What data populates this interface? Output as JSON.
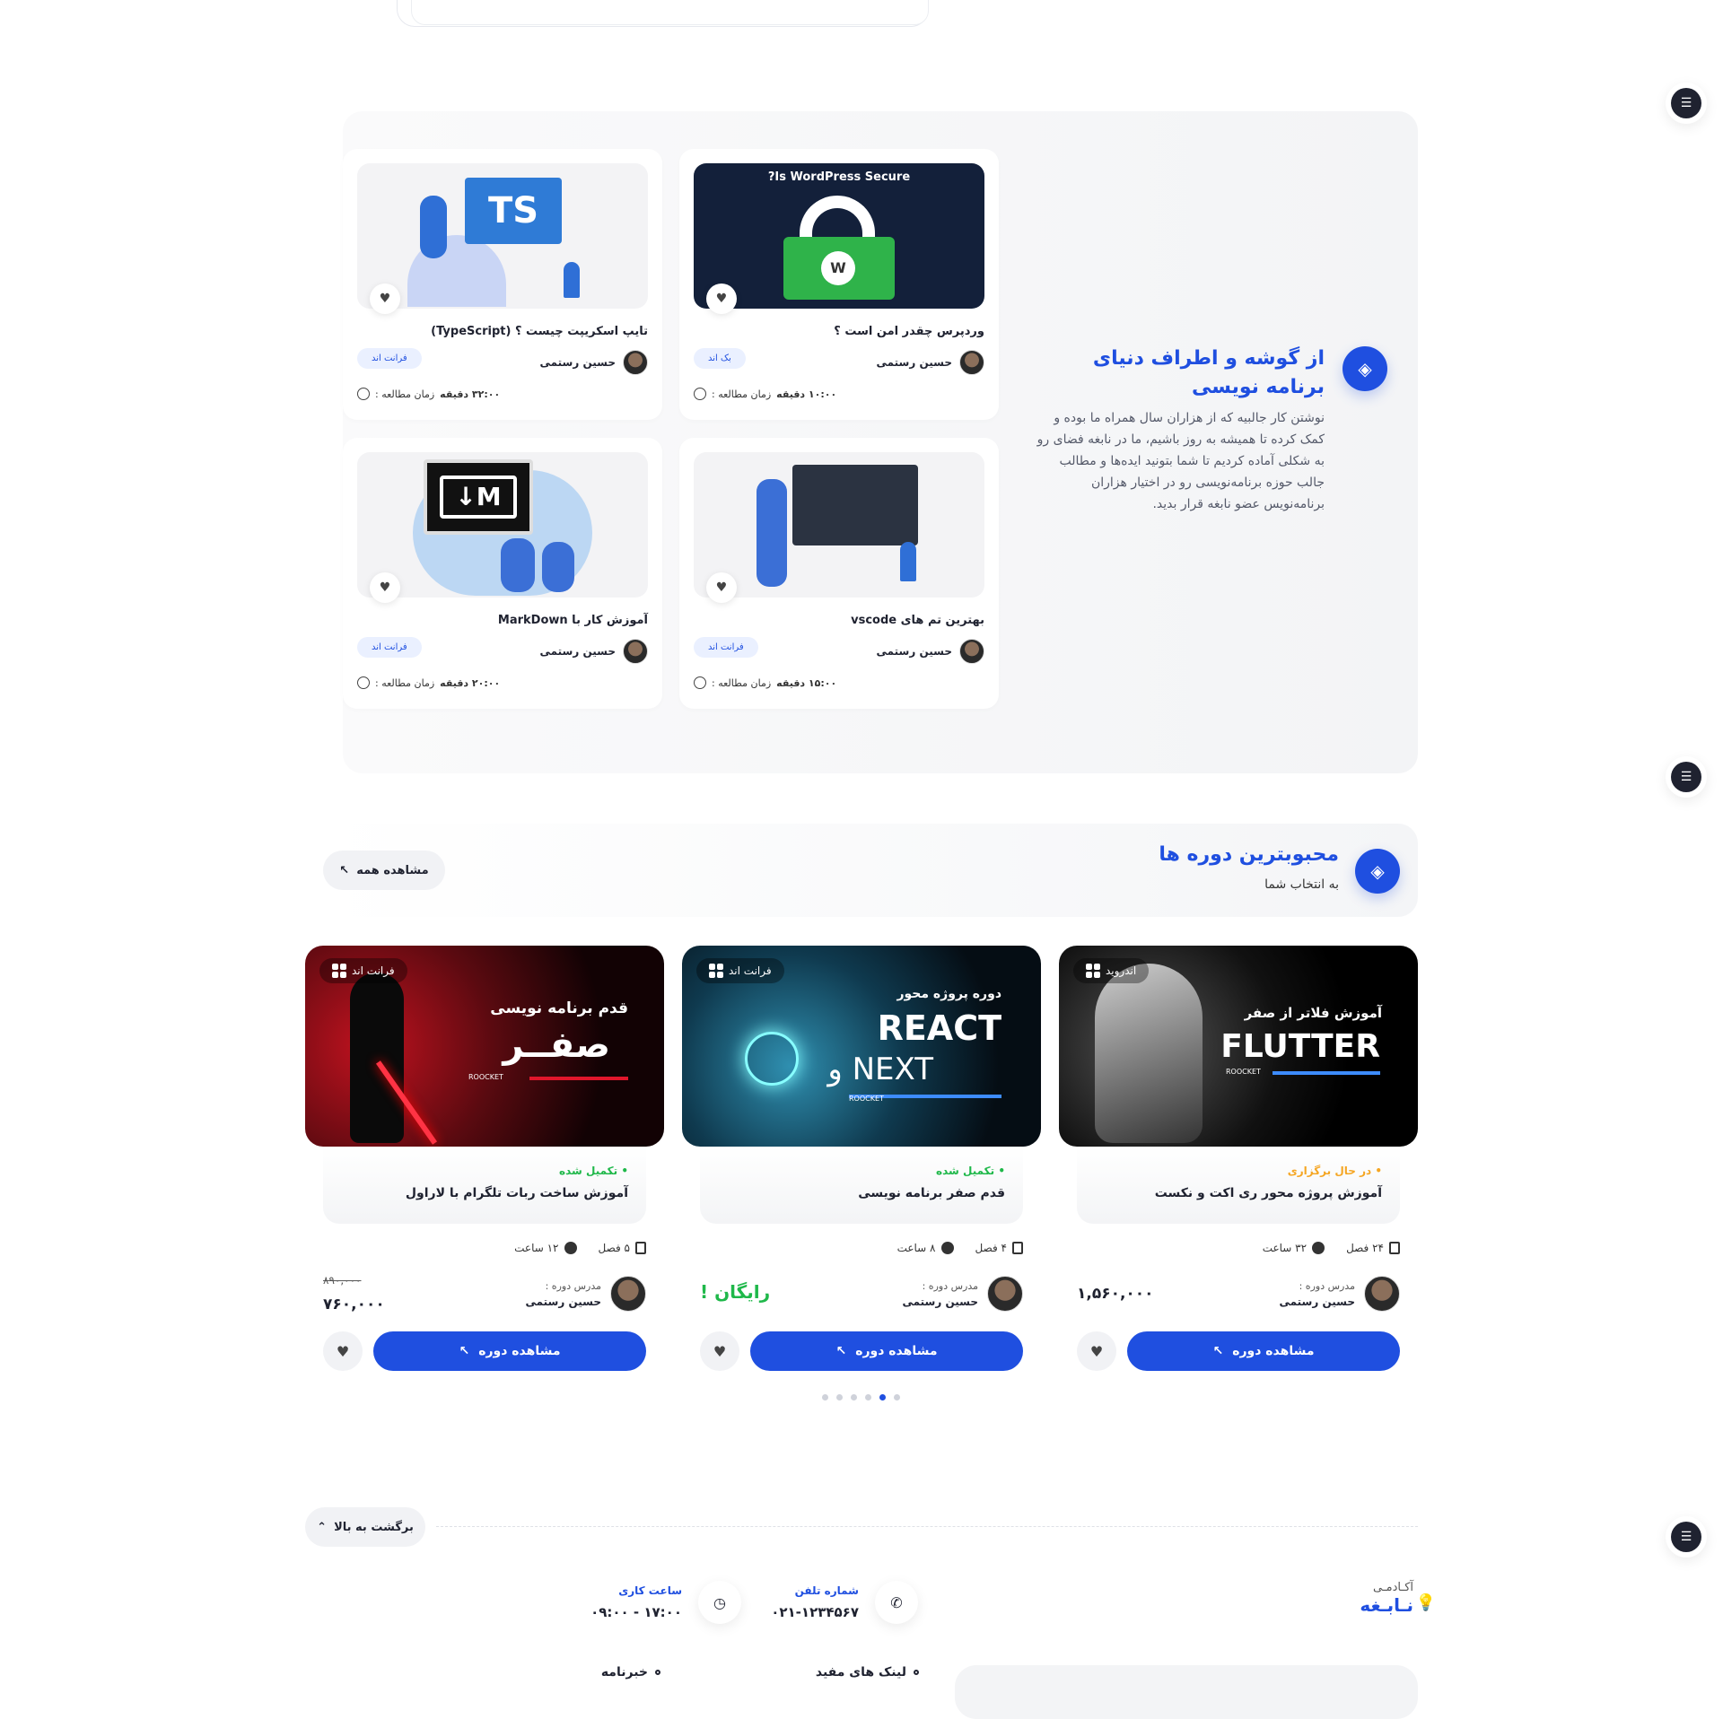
{
  "blog": {
    "title": "از گوشه و اطراف دنیای برنامه نویسی",
    "description": "نوشتن کار جالبیه که از هزاران سال همراه ما بوده و کمک کرده تا همیشه به روز باشیم، ما در نابغه فضای رو به شکلی آماده کردیم تا شما بتونید ایده‌ها و مطالب جالب حوزه برنامه‌نویسی رو در اختیار هزاران برنامه‌نویس عضو نابغه قرار بدید.",
    "read_label": "زمان مطالعه :",
    "posts": [
      {
        "title": "وردپرس چقدر امن است ؟",
        "author": "حسین رستمی",
        "tag": "بک اند",
        "read_time": "۱۰:۰۰ دقیقه",
        "image_text": "Is WordPress Secure?"
      },
      {
        "title": "تایپ اسکریپت چیست ؟ (TypeScript)",
        "author": "حسین رستمی",
        "tag": "فرانت اند",
        "read_time": "۳۲:۰۰ دقیقه",
        "image_text": "TS"
      },
      {
        "title": "بهترین تم های vscode",
        "author": "حسین رستمی",
        "tag": "فرانت اند",
        "read_time": "۱۵:۰۰ دقیقه"
      },
      {
        "title": "آموزش کار با MarkDown",
        "author": "حسین رستمی",
        "tag": "فرانت اند",
        "read_time": "۲۰:۰۰ دقیقه",
        "image_text": "M↓"
      }
    ]
  },
  "popular": {
    "title": "محبوبترین دوره ها",
    "subtitle": "به انتخاب شما",
    "see_all": "مشاهده همه",
    "teacher_label": "مدرس دوره :",
    "button_label": "مشاهده دوره",
    "courses": [
      {
        "category": "اندروید",
        "status": "در حال برگزاری",
        "status_color": "#f5a623",
        "title": "آموزش پروژه محور ری اکت و نکست",
        "chapters": "۲۴ فصل",
        "hours": "۳۲ ساعت",
        "teacher": "حسین رستمی",
        "price": "۱,۵۶۰,۰۰۰",
        "cover_line1": "آموزش فلاتر از صفر",
        "cover_line2": "FLUTTER",
        "cover_brand": "ROOCKET"
      },
      {
        "category": "فرانت اند",
        "status": "تکمیل شده",
        "status_color": "#1fb84a",
        "title": "قدم صفر برنامه نویسی",
        "chapters": "۴ فصل",
        "hours": "۸ ساعت",
        "teacher": "حسین رستمی",
        "price": "رایگان !",
        "cover_line1": "دوره پروژه محور",
        "cover_line2": "REACT",
        "cover_line3": "NEXT و",
        "cover_brand": "ROOCKET"
      },
      {
        "category": "فرانت اند",
        "status": "تکمیل شده",
        "status_color": "#1fb84a",
        "title": "آموزش ساخت ربات تلگرام با لاراول",
        "chapters": "۵ فصل",
        "hours": "۱۲ ساعت",
        "teacher": "حسین رستمی",
        "old_price": "۸۹۰,۰۰۰",
        "price": "۷۶۰,۰۰۰",
        "cover_line1": "قدم  برنامه نویسی",
        "cover_line2": "صفــر",
        "cover_brand": "ROOCKET"
      }
    ]
  },
  "footer": {
    "back_to_top": "برگشت به بالا",
    "brand_small": "آکـادمـی",
    "brand_big": "نـابـغه",
    "phone_label": "شماره تلفن",
    "phone": "۰۲۱-۱۲۳۴۵۶۷",
    "hours_label": "ساعت کاری",
    "hours": "۰۹:۰۰ - ۱۷:۰۰",
    "links_heading": "لینک های مفید",
    "news_heading": "خبرنامه"
  },
  "colors": {
    "accent": "#1f4fe0",
    "success": "#1fb84a",
    "warning": "#f5a623"
  }
}
